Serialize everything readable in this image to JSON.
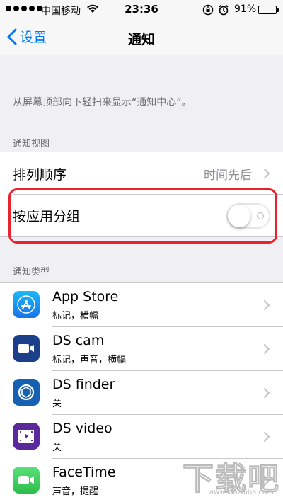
{
  "status_bar": {
    "carrier": "中国移动",
    "time": "23:36",
    "battery_percent": "91%",
    "battery_level": 0.91,
    "signal_dots": 5
  },
  "nav": {
    "back_label": "设置",
    "title": "通知"
  },
  "description": "从屏幕顶部向下轻扫来显示“通知中心”。",
  "notification_view": {
    "header": "通知视图",
    "sort_label": "排列顺序",
    "sort_value": "时间先后",
    "group_label": "按应用分组",
    "group_enabled": false
  },
  "notification_types": {
    "header": "通知类型",
    "apps": [
      {
        "name": "App Store",
        "detail": "标记，横幅",
        "icon": "app-store-icon",
        "color": "#1a8ef0"
      },
      {
        "name": "DS cam",
        "detail": "标记，声音，横幅",
        "icon": "ds-cam-icon",
        "color": "#2860b8"
      },
      {
        "name": "DS finder",
        "detail": "关",
        "icon": "ds-finder-icon",
        "color": "#1e70c8"
      },
      {
        "name": "DS video",
        "detail": "关",
        "icon": "ds-video-icon",
        "color": "#6a3fb0"
      },
      {
        "name": "FaceTime",
        "detail": "声音，提醒",
        "icon": "facetime-icon",
        "color": "#3fd15a"
      }
    ]
  },
  "watermark": {
    "text": "下载吧",
    "url": "www.xiazaiba.com"
  },
  "colors": {
    "accent": "#007aff",
    "highlight": "#e8232e",
    "background": "#efeff4"
  }
}
